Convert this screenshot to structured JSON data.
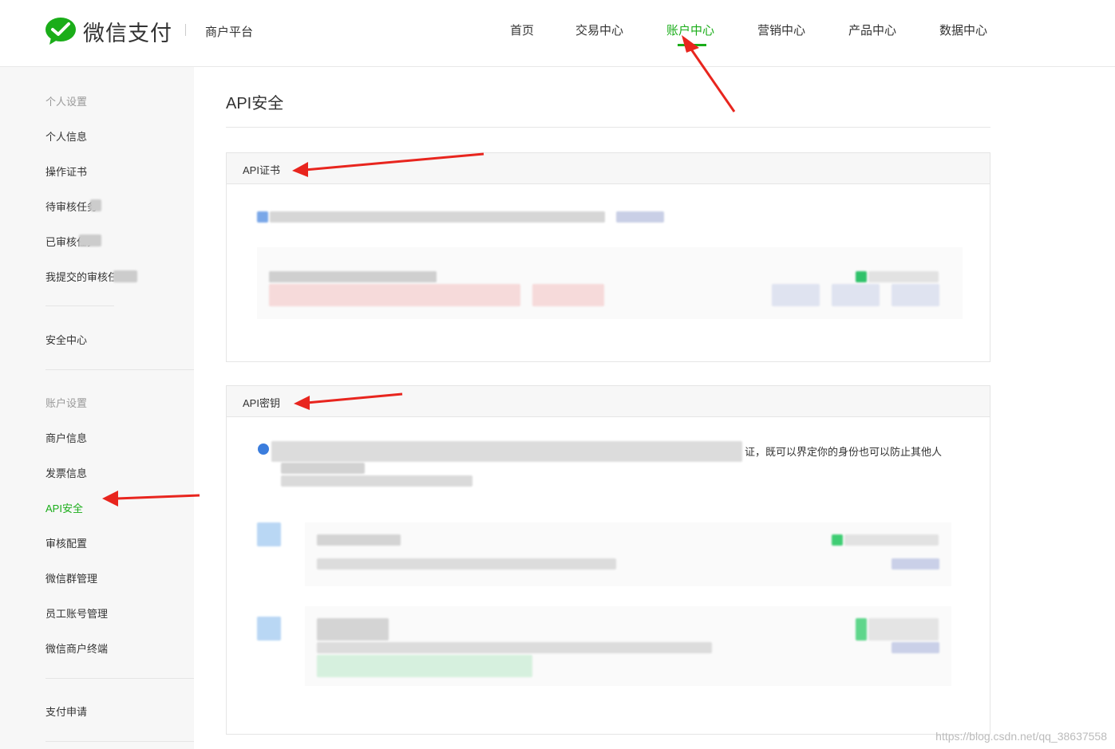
{
  "header": {
    "logo_text": "微信支付",
    "platform": "商户平台",
    "nav": [
      "首页",
      "交易中心",
      "账户中心",
      "营销中心",
      "产品中心",
      "数据中心"
    ],
    "active_nav": "账户中心"
  },
  "sidebar": {
    "group_personal": "个人设置",
    "personal_items": [
      "个人信息",
      "操作证书",
      "待审核任务",
      "已审核任务",
      "我提交的审核任务"
    ],
    "security": "安全中心",
    "group_account": "账户设置",
    "account_items": [
      "商户信息",
      "发票信息",
      "API安全",
      "审核配置",
      "微信群管理",
      "员工账号管理",
      "微信商户终端"
    ],
    "active_item": "API安全",
    "pay_apply": "支付申请"
  },
  "main": {
    "title": "API安全",
    "cert_panel_title": "API证书",
    "key_panel_title": "API密钥",
    "key_desc_visible": "证，既可以界定你的身份也可以防止其他人"
  },
  "colors": {
    "accent": "#1aad19",
    "annotation": "#e8251e"
  },
  "watermark": "https://blog.csdn.net/qq_38637558"
}
